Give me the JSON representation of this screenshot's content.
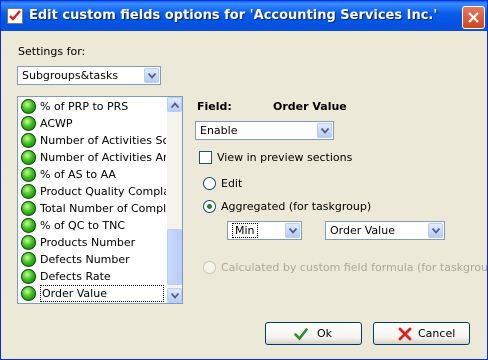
{
  "window": {
    "title": "Edit custom fields options for  'Accounting Services Inc.'"
  },
  "settings": {
    "label": "Settings for:",
    "selected": "Subgroups&tasks"
  },
  "fields_list": {
    "items": [
      "% of PRP to PRS",
      "ACWP",
      "Number of Activities Sche",
      "Number of Activities Arran",
      "% of AS to AA",
      "Product Quality Complaint:",
      "Total Number of Complain",
      "% of QC to TNC",
      "Products Number",
      "Defects Number",
      "Defects Rate",
      "Order Value"
    ],
    "selected": "Order Value"
  },
  "field_panel": {
    "field_label": "Field:",
    "field_name": "Order Value",
    "enable_select": "Enable",
    "preview_checkbox": "View in preview sections",
    "preview_checked": false,
    "radio_edit": "Edit",
    "radio_aggregated": "Aggregated (for taskgroup)",
    "selected_mode": "aggregated",
    "aggregate_function": "Min",
    "aggregate_field": "Order Value",
    "radio_formula": "Calculated by custom field formula (for taskgroup)"
  },
  "buttons": {
    "ok": "Ok",
    "cancel": "Cancel"
  },
  "colors": {
    "title_bar": "#0054e3",
    "dialog_bg": "#ece9d8",
    "ok_check": "#2e8b2e",
    "cancel_x": "#d82020"
  }
}
